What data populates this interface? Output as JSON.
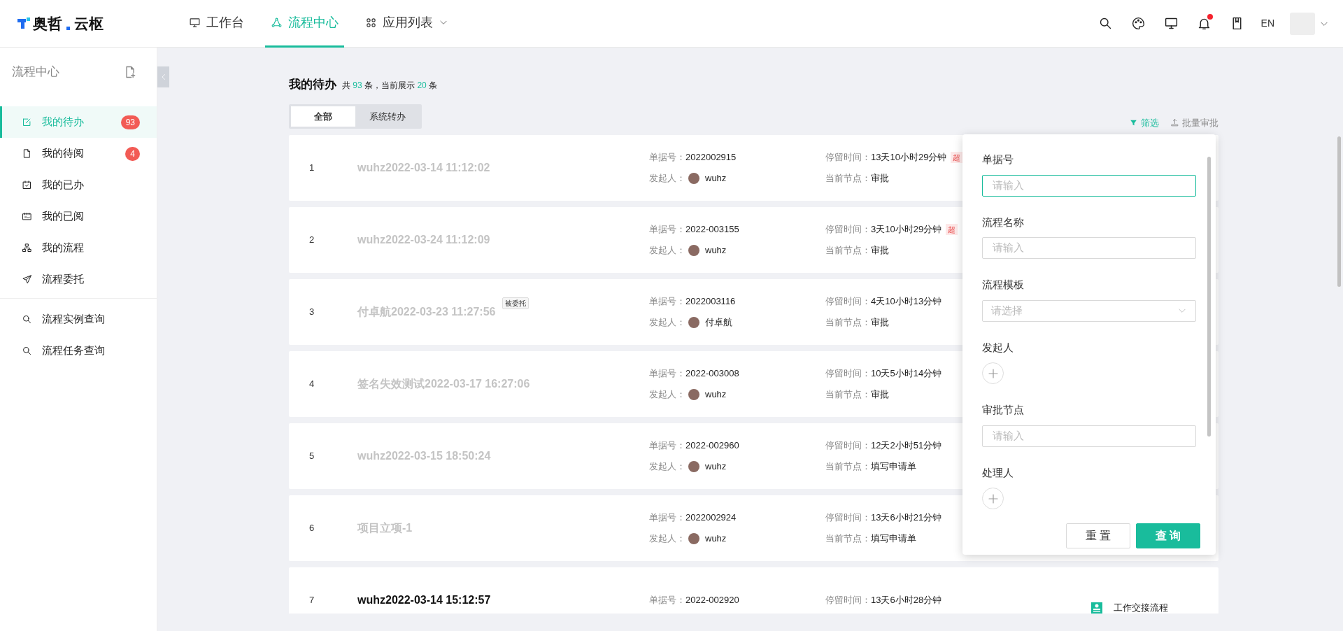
{
  "header": {
    "logo": {
      "left": "奥哲",
      "right": "云枢"
    },
    "nav": [
      {
        "label": "工作台",
        "selected": false,
        "dropdown": false
      },
      {
        "label": "流程中心",
        "selected": true,
        "dropdown": false
      },
      {
        "label": "应用列表",
        "selected": false,
        "dropdown": true
      }
    ],
    "tools": [
      {
        "unread": false
      },
      {
        "unread": false
      },
      {
        "unread": false
      },
      {
        "unread": true
      },
      {
        "unread": false
      }
    ],
    "language": "EN"
  },
  "sidebar": {
    "title": "流程中心",
    "items": [
      {
        "label": "我的待办",
        "badge": "93",
        "selected": true
      },
      {
        "label": "我的待阅",
        "badge": "4",
        "selected": false
      },
      {
        "label": "我的已办",
        "selected": false
      },
      {
        "label": "我的已阅",
        "selected": false
      },
      {
        "label": "我的流程",
        "selected": false
      },
      {
        "label": "流程委托",
        "selected": false
      }
    ],
    "query_items": [
      {
        "label": "流程实例查询",
        "selected": false
      },
      {
        "label": "流程任务查询",
        "selected": false
      }
    ]
  },
  "page": {
    "title": "我的待办",
    "summary": {
      "prefix": "共",
      "total": "93",
      "middle": "条，当前展示",
      "shown": "20",
      "suffix": "条"
    },
    "tabs": [
      {
        "label": "全部",
        "selected": true
      },
      {
        "label": "系统转办",
        "selected": false
      }
    ],
    "actions": [
      {
        "label": "筛选",
        "active": true
      },
      {
        "label": "批量审批",
        "active": false
      }
    ]
  },
  "rows": [
    {
      "index": "1",
      "title": "wuhz2022-03-14 11:12:02",
      "unread": false,
      "doc": {
        "label": "单据号：",
        "value": "2022002915"
      },
      "initiator": {
        "label": "发起人：",
        "value": "wuhz"
      },
      "stay": {
        "label": "停留时间：",
        "value": "13天10小时29分钟"
      },
      "node": {
        "label": "当前节点：",
        "value": "审批"
      },
      "overdue": "超"
    },
    {
      "index": "2",
      "title": "wuhz2022-03-24 11:12:09",
      "unread": false,
      "doc": {
        "label": "单据号：",
        "value": "2022-003155"
      },
      "initiator": {
        "label": "发起人：",
        "value": "wuhz"
      },
      "stay": {
        "label": "停留时间：",
        "value": "3天10小时29分钟"
      },
      "node": {
        "label": "当前节点：",
        "value": "审批"
      },
      "overdue": "超"
    },
    {
      "index": "3",
      "title": "付卓航2022-03-23 11:27:56",
      "tag": "被委托",
      "unread": false,
      "doc": {
        "label": "单据号：",
        "value": "2022003116"
      },
      "initiator": {
        "label": "发起人：",
        "value": "付卓航"
      },
      "stay": {
        "label": "停留时间：",
        "value": "4天10小时13分钟"
      },
      "node": {
        "label": "当前节点：",
        "value": "审批"
      }
    },
    {
      "index": "4",
      "title": "签名失效测试2022-03-17 16:27:06",
      "unread": false,
      "doc": {
        "label": "单据号：",
        "value": "2022-003008"
      },
      "initiator": {
        "label": "发起人：",
        "value": "wuhz"
      },
      "stay": {
        "label": "停留时间：",
        "value": "10天5小时14分钟"
      },
      "node": {
        "label": "当前节点：",
        "value": "审批"
      }
    },
    {
      "index": "5",
      "title": "wuhz2022-03-15 18:50:24",
      "unread": false,
      "doc": {
        "label": "单据号：",
        "value": "2022-002960"
      },
      "initiator": {
        "label": "发起人：",
        "value": "wuhz"
      },
      "stay": {
        "label": "停留时间：",
        "value": "12天2小时51分钟"
      },
      "node": {
        "label": "当前节点：",
        "value": "填写申请单"
      }
    },
    {
      "index": "6",
      "title": "项目立项-1",
      "unread": false,
      "doc": {
        "label": "单据号：",
        "value": "2022002924"
      },
      "initiator": {
        "label": "发起人：",
        "value": "wuhz"
      },
      "stay": {
        "label": "停留时间：",
        "value": "13天6小时21分钟"
      },
      "node": {
        "label": "当前节点：",
        "value": "填写申请单"
      }
    },
    {
      "index": "7",
      "title": "wuhz2022-03-14 15:12:57",
      "unread": true,
      "doc": {
        "label": "单据号：",
        "value": "2022-002920"
      },
      "stay": {
        "label": "停留时间：",
        "value": "13天6小时28分钟"
      },
      "app": "工作交接流程"
    }
  ],
  "filter": {
    "fields": [
      {
        "label": "单据号",
        "kind": "input",
        "placeholder": "请输入",
        "focused": true
      },
      {
        "label": "流程名称",
        "kind": "input",
        "placeholder": "请输入",
        "focused": false
      },
      {
        "label": "流程模板",
        "kind": "select",
        "placeholder": "请选择",
        "focused": false
      },
      {
        "label": "发起人",
        "kind": "picker"
      },
      {
        "label": "审批节点",
        "kind": "input",
        "placeholder": "请输入",
        "focused": false
      },
      {
        "label": "处理人",
        "kind": "picker"
      }
    ],
    "buttons": [
      {
        "label": "重 置",
        "kind": "secondary"
      },
      {
        "label": "查 询",
        "kind": "primary"
      }
    ]
  }
}
